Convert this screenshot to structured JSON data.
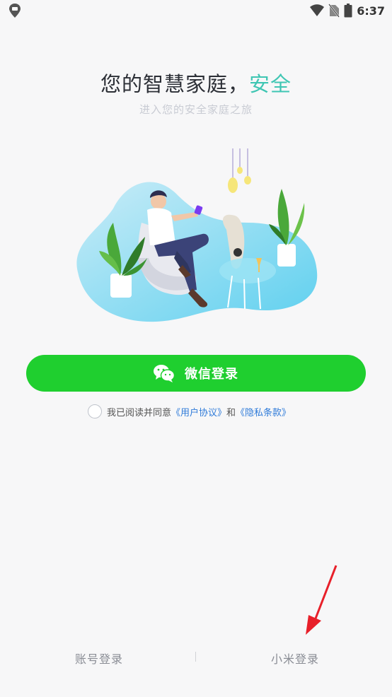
{
  "status_bar": {
    "time": "6:37",
    "icons": [
      "location-pin-icon",
      "wifi-icon",
      "no-sim-icon",
      "battery-icon"
    ]
  },
  "header": {
    "title_main": "您的智慧家庭，",
    "title_accent": "安全",
    "subtitle": "进入您的安全家庭之旅"
  },
  "login": {
    "wechat_label": "微信登录",
    "wechat_icon": "wechat-icon"
  },
  "agreement": {
    "prefix": "我已阅读并同意",
    "user_agreement": "《用户协议》",
    "conjunction": "和",
    "privacy_policy": "《隐私条款》"
  },
  "bottom": {
    "account_login": "账号登录",
    "mi_login": "小米登录"
  },
  "colors": {
    "accent": "#3fc6b3",
    "wechat_green": "#1fcf2f",
    "link": "#2f7bd9",
    "arrow": "#e8202a"
  }
}
